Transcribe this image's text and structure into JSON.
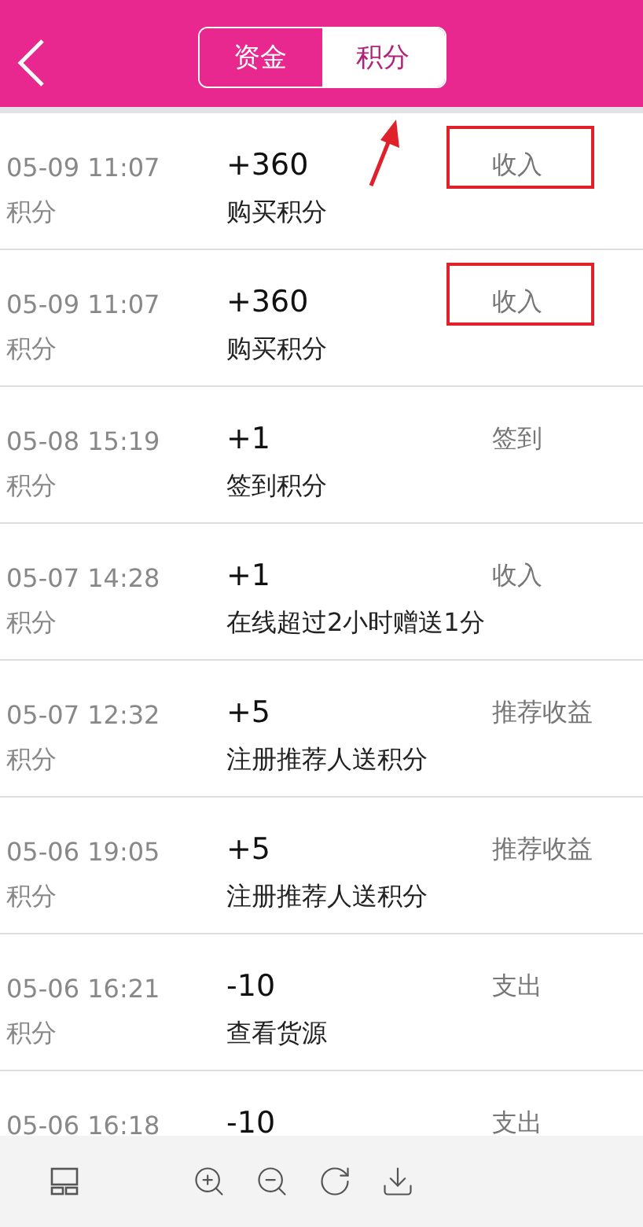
{
  "header": {
    "tabs": [
      {
        "label": "资金",
        "selected": false
      },
      {
        "label": "积分",
        "selected": true
      }
    ]
  },
  "rows": [
    {
      "time": "05-09 11:07",
      "amount": "+360",
      "type": "收入",
      "category": "积分",
      "description": "购买积分",
      "annotated": true
    },
    {
      "time": "05-09 11:07",
      "amount": "+360",
      "type": "收入",
      "category": "积分",
      "description": "购买积分",
      "annotated": true
    },
    {
      "time": "05-08 15:19",
      "amount": "+1",
      "type": "签到",
      "category": "积分",
      "description": "签到积分",
      "annotated": false
    },
    {
      "time": "05-07 14:28",
      "amount": "+1",
      "type": "收入",
      "category": "积分",
      "description": "在线超过2小时赠送1分",
      "annotated": false
    },
    {
      "time": "05-07 12:32",
      "amount": "+5",
      "type": "推荐收益",
      "category": "积分",
      "description": "注册推荐人送积分",
      "annotated": false
    },
    {
      "time": "05-06 19:05",
      "amount": "+5",
      "type": "推荐收益",
      "category": "积分",
      "description": "注册推荐人送积分",
      "annotated": false
    },
    {
      "time": "05-06 16:21",
      "amount": "-10",
      "type": "支出",
      "category": "积分",
      "description": "查看货源",
      "annotated": false
    },
    {
      "time": "05-06 16:18",
      "amount": "-10",
      "type": "支出",
      "annotated": false
    }
  ]
}
